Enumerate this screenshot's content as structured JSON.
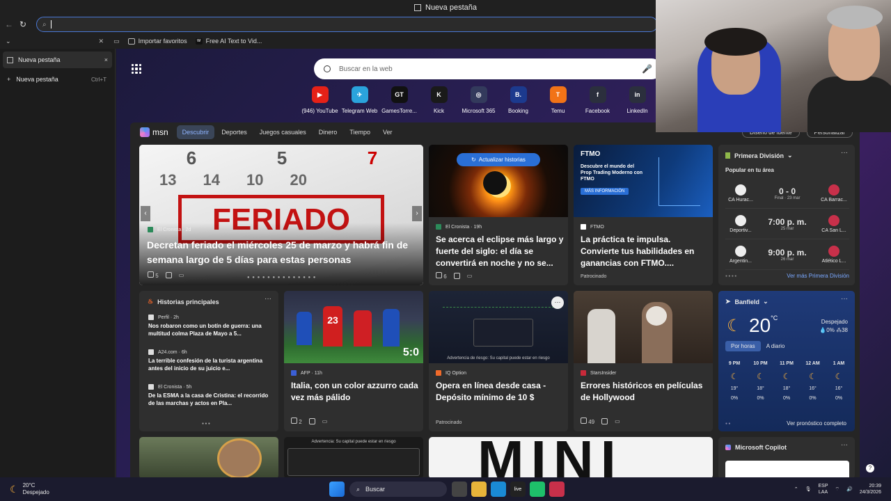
{
  "window": {
    "title": "Nueva pestaña"
  },
  "address": {
    "value": "",
    "placeholder": ""
  },
  "favorites": [
    {
      "label": "Importar favoritos"
    },
    {
      "label": "Free AI Text to Vid..."
    }
  ],
  "sidebar": {
    "tabs": [
      {
        "label": "Nueva pestaña",
        "close": "×"
      }
    ],
    "new_tab": {
      "label": "Nueva pestaña",
      "shortcut": "Ctrl+T"
    }
  },
  "search": {
    "placeholder": "Buscar en la web"
  },
  "quicklinks": [
    {
      "label": "(946) YouTube",
      "color": "#e62117",
      "glyph": "▶"
    },
    {
      "label": "Telegram Web",
      "color": "#2aa3dc",
      "glyph": "✈"
    },
    {
      "label": "GamesTorre...",
      "color": "#111111",
      "glyph": "GT"
    },
    {
      "label": "Kick",
      "color": "#1a1a1a",
      "glyph": "K"
    },
    {
      "label": "Microsoft 365",
      "color": "#333a5c",
      "glyph": "◎"
    },
    {
      "label": "Booking",
      "color": "#1c3a8e",
      "glyph": "B."
    },
    {
      "label": "Temu",
      "color": "#f27317",
      "glyph": "T"
    },
    {
      "label": "Facebook",
      "color": "#2b2f3d",
      "glyph": "f"
    },
    {
      "label": "LinkedIn",
      "color": "#2b2f3d",
      "glyph": "in"
    }
  ],
  "feed": {
    "logo": "msn",
    "tabs": [
      "Descubrir",
      "Deportes",
      "Juegos casuales",
      "Dinero",
      "Tiempo",
      "Ver"
    ],
    "buttons": [
      "Diseño de fuente",
      "Personalizar"
    ],
    "hero": {
      "source": "El Cronista · 2d",
      "title": "Decretan feriado el miércoles 25 de marzo y habrá fin de semana largo de 5 días para estas personas",
      "likes": "5",
      "image_text": "FERIADO",
      "cal": [
        "6",
        "5",
        "7",
        "13",
        "14",
        "10",
        "20"
      ]
    },
    "eclipse": {
      "update": "Actualizar historias",
      "source": "El Cronista · 19h",
      "title": "Se acerca el eclipse más largo y fuerte del siglo: el día se convertirá en noche y no se...",
      "likes": "6"
    },
    "ftmo": {
      "brand": "FTMO",
      "ad_text": "Descubre el mundo del Prop Trading Moderno con FTMO",
      "cta": "MÁS INFORMACIÓN",
      "source": "FTMO",
      "title": "La práctica te impulsa. Convierte tus habilidades en ganancias con FTMO....",
      "sponsored": "Patrocinado"
    },
    "league": {
      "title": "Primera División",
      "subtitle": "Popular en tu área",
      "matches": [
        {
          "home": "CA Hurac...",
          "away": "CA Barrac...",
          "center": "0 - 0",
          "sub": "Final · 23 mar"
        },
        {
          "home": "Deportiv...",
          "away": "CA San L...",
          "center": "7:00 p. m.",
          "sub": "25 mar"
        },
        {
          "home": "Argentin...",
          "away": "Atlético L...",
          "center": "9:00 p. m.",
          "sub": "26 mar"
        }
      ],
      "more": "Ver más Primera División"
    },
    "top": {
      "title": "Historias principales",
      "items": [
        {
          "source": "Perfil · 2h",
          "title": "Nos robaron como un botín de guerra: una multitud colma Plaza de Mayo a 5..."
        },
        {
          "source": "A24.com · 6h",
          "title": "La terrible confesión de la turista argentina antes del inicio de su juicio e..."
        },
        {
          "source": "El Cronista · 5h",
          "title": "De la ESMA a la casa de Cristina: el recorrido de las marchas y actos en Pla..."
        }
      ]
    },
    "italia": {
      "source": "AFP · 11h",
      "title": "Italia, con un color azzurro cada vez más pálido",
      "likes": "2",
      "score": "5:0",
      "jersey": "23"
    },
    "iq": {
      "warning": "Advertencia de riesgo: Su capital puede estar en riesgo",
      "source": "IQ Option",
      "title": "Opera en línea desde casa - Depósito mínimo de 10 $",
      "sponsored": "Patrocinado"
    },
    "hollywood": {
      "source": "StarsInsider",
      "title": "Errores históricos en películas de Hollywood",
      "likes": "49"
    },
    "weather": {
      "city": "Banfield",
      "temp": "20",
      "unit": "°C",
      "condition": "Despejado",
      "stats": "💧0%  ⁂38",
      "tabs": [
        "Por horas",
        "A diario"
      ],
      "hours": [
        {
          "h": "9 PM",
          "t": "19°",
          "p": "0%"
        },
        {
          "h": "10 PM",
          "t": "18°",
          "p": "0%"
        },
        {
          "h": "11 PM",
          "t": "18°",
          "p": "0%"
        },
        {
          "h": "12 AM",
          "t": "16°",
          "p": "0%"
        },
        {
          "h": "1 AM",
          "t": "16°",
          "p": "0%"
        }
      ],
      "more": "Ver pronóstico completo"
    },
    "copilot": {
      "title": "Microsoft Copilot"
    },
    "bottom_ad": "Advertencia: Su capital puede estar en riesgo",
    "mini_text": "MINI"
  },
  "taskbar": {
    "weather_temp": "20°C",
    "weather_cond": "Despejado",
    "search": "Buscar",
    "lang": "ESP",
    "lang2": "LAA",
    "time": "20:39",
    "date": "24/3/2026"
  }
}
